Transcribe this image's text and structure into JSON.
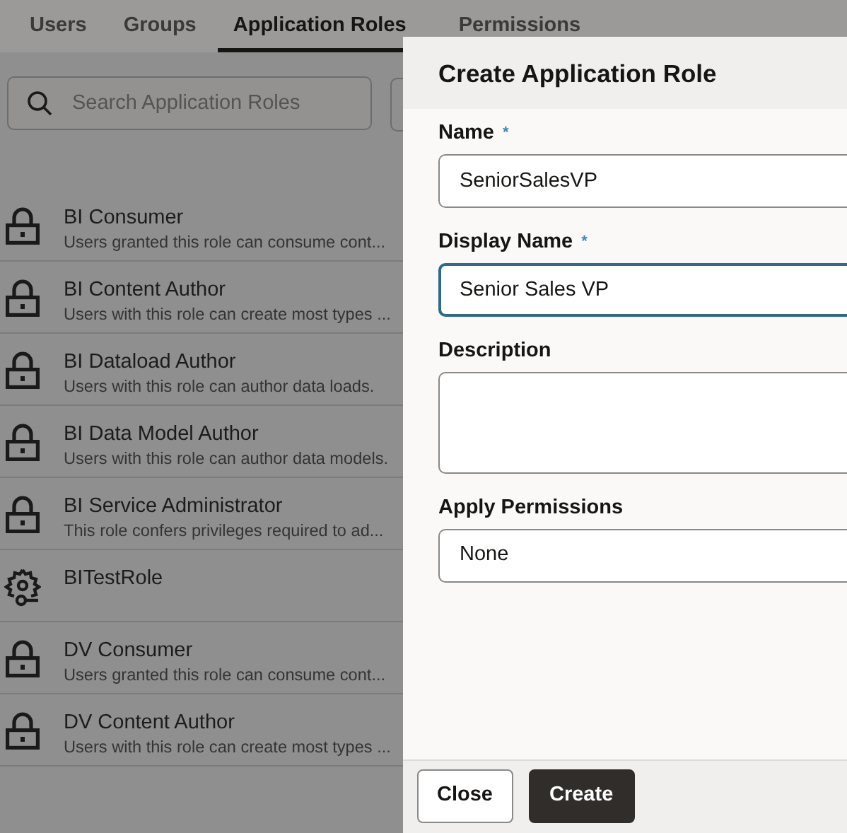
{
  "tabs": [
    {
      "label": "Users",
      "selected": false
    },
    {
      "label": "Groups",
      "selected": false
    },
    {
      "label": "Application Roles",
      "selected": true
    },
    {
      "label": "Permissions",
      "selected": false
    }
  ],
  "search": {
    "placeholder": "Search Application Roles"
  },
  "roles": [
    {
      "kind": "lock",
      "name": "BI Consumer",
      "description": "Users granted this role can consume cont..."
    },
    {
      "kind": "lock",
      "name": "BI Content Author",
      "description": "Users with this role can create most types ..."
    },
    {
      "kind": "lock",
      "name": "BI Dataload Author",
      "description": "Users with this role can author data loads."
    },
    {
      "kind": "lock",
      "name": "BI Data Model Author",
      "description": "Users with this role can author data models."
    },
    {
      "kind": "lock",
      "name": "BI Service Administrator",
      "description": "This role confers privileges required to ad..."
    },
    {
      "kind": "gear",
      "name": "BITestRole"
    },
    {
      "kind": "lock",
      "name": "DV Consumer",
      "description": "Users granted this role can consume cont..."
    },
    {
      "kind": "lock",
      "name": "DV Content Author",
      "description": "Users with this role can create most types ..."
    }
  ],
  "dialog": {
    "title": "Create Application Role",
    "fields": [
      {
        "kind": "input",
        "label": "Name",
        "required_mark": "*",
        "value": "SeniorSalesVP",
        "focused": false
      },
      {
        "kind": "input",
        "label": "Display Name",
        "required_mark": "*",
        "value": "Senior Sales VP",
        "focused": true
      },
      {
        "kind": "textarea",
        "label": "Description",
        "focused": false
      },
      {
        "kind": "select",
        "label": "Apply Permissions",
        "value": "None",
        "focused": false
      }
    ],
    "buttons": [
      {
        "kind": "secondary",
        "label": "Close"
      },
      {
        "kind": "primary",
        "label": "Create"
      }
    ]
  }
}
